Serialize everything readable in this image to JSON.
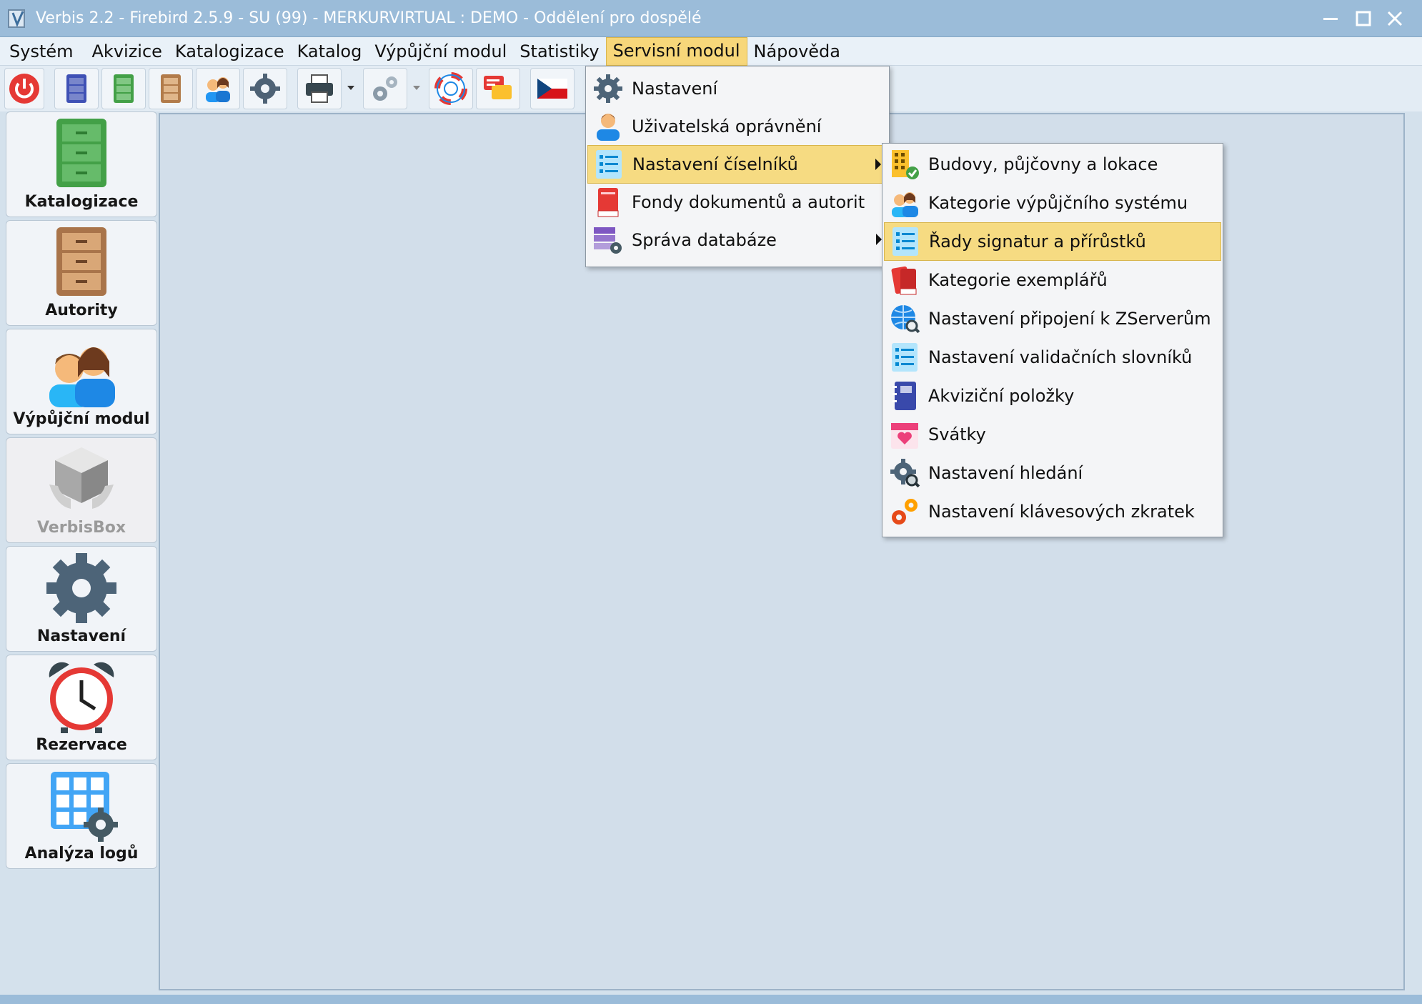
{
  "window": {
    "title": "Verbis 2.2 - Firebird 2.5.9 - SU (99) - MERKURVIRTUAL : DEMO - Oddělení pro dospělé"
  },
  "menubar": [
    {
      "label": "Systém"
    },
    {
      "label": "Akvizice"
    },
    {
      "label": "Katalogizace"
    },
    {
      "label": "Katalog"
    },
    {
      "label": "Výpůjční modul"
    },
    {
      "label": "Statistiky"
    },
    {
      "label": "Servisní modul"
    },
    {
      "label": "Nápověda"
    }
  ],
  "sidebar": [
    {
      "label": "Katalogizace",
      "icon": "green-cabinet-icon"
    },
    {
      "label": "Autority",
      "icon": "brown-cabinet-icon"
    },
    {
      "label": "Výpůjční modul",
      "icon": "people-icon"
    },
    {
      "label": "VerbisBox",
      "icon": "box-icon"
    },
    {
      "label": "Nastavení",
      "icon": "gear-icon"
    },
    {
      "label": "Rezervace",
      "icon": "alarm-clock-icon"
    },
    {
      "label": "Analýza logů",
      "icon": "grid-gear-icon"
    }
  ],
  "servis_menu": [
    {
      "label": "Nastavení",
      "icon": "gear-icon"
    },
    {
      "label": "Uživatelská oprávnění",
      "icon": "user-icon"
    },
    {
      "label": "Nastavení číselníků",
      "icon": "list-icon",
      "submenu": true
    },
    {
      "label": "Fondy dokumentů a autorit",
      "icon": "book-icon"
    },
    {
      "label": "Správa databáze",
      "icon": "database-gear-icon",
      "submenu": true
    }
  ],
  "ciselniky_menu": [
    {
      "label": "Budovy, půjčovny a lokace",
      "icon": "building-icon"
    },
    {
      "label": "Kategorie výpůjčního systému",
      "icon": "people-icon"
    },
    {
      "label": "Řady signatur a přírůstků",
      "icon": "list-icon"
    },
    {
      "label": "Kategorie exemplářů",
      "icon": "books-icon"
    },
    {
      "label": "Nastavení připojení k ZServerům",
      "icon": "globe-search-icon"
    },
    {
      "label": "Nastavení validačních slovníků",
      "icon": "list-icon"
    },
    {
      "label": "Akviziční položky",
      "icon": "notebook-icon"
    },
    {
      "label": "Svátky",
      "icon": "calendar-heart-icon"
    },
    {
      "label": "Nastavení hledání",
      "icon": "gear-search-icon"
    },
    {
      "label": "Nastavení klávesových zkratek",
      "icon": "gears-icon"
    }
  ]
}
